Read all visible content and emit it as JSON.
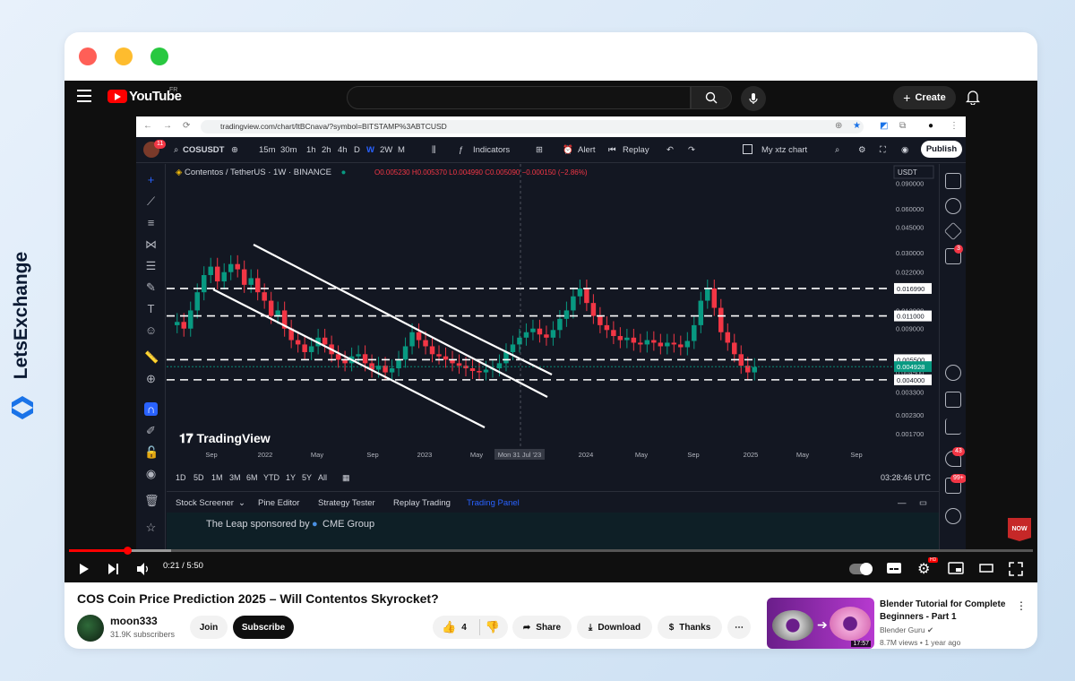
{
  "brand": {
    "name": "LetsExchange"
  },
  "window": {
    "dots": [
      "#ff5f57",
      "#febc2e",
      "#28c840"
    ]
  },
  "youtube": {
    "logo_text": "YouTube",
    "country": "FR",
    "create_label": "Create"
  },
  "browser": {
    "url": "tradingview.com/chart/ltBCnava/?symbol=BITSTAMP%3ABTCUSD"
  },
  "tradingview": {
    "avatar_badge": "11",
    "symbol": "COSUSDT",
    "intervals": [
      "15m",
      "30m",
      "1h",
      "2h",
      "4h",
      "D",
      "W",
      "2W",
      "M"
    ],
    "active_interval": "W",
    "indicators_label": "Indicators",
    "alert_label": "Alert",
    "replay_label": "Replay",
    "layout_name": "My xtz chart",
    "publish_label": "Publish",
    "symbol_line": "Contentos / TetherUS · 1W · BINANCE",
    "ohlc": "O0.005230 H0.005370 L0.004990 C0.005090 −0.000150 (−2.86%)",
    "currency": "USDT",
    "watermark": "TradingView",
    "ranges": [
      "1D",
      "5D",
      "1M",
      "3M",
      "6M",
      "YTD",
      "1Y",
      "5Y",
      "All"
    ],
    "clock": "03:28:46 UTC",
    "panel_tabs": [
      "Stock Screener",
      "Pine Editor",
      "Strategy Tester",
      "Replay Trading",
      "Trading Panel"
    ],
    "active_panel_tab": "Trading Panel",
    "panel_text": "The Leap sponsored by",
    "panel_brand": "CME Group",
    "right_badges": {
      "alerts": "3",
      "notifications": "43",
      "news": "99+"
    },
    "now_badge": "NOW"
  },
  "chart_data": {
    "type": "candlestick",
    "title": "Contentos / TetherUS · 1W · BINANCE",
    "x_ticks": [
      "Sep",
      "2022",
      "May",
      "Sep",
      "2023",
      "May",
      "Mon 31 Jul '23",
      "2024",
      "May",
      "Sep",
      "2025",
      "May",
      "Sep"
    ],
    "y_scale": "log",
    "y_ticks": [
      "0.090000",
      "0.060000",
      "0.045000",
      "0.030000",
      "0.022000",
      "0.012000",
      "0.009000",
      "0.004500",
      "0.003300",
      "0.002300",
      "0.001700"
    ],
    "horizontal_levels": [
      "0.016990",
      "0.011000",
      "0.005500",
      "0.004000"
    ],
    "last_price": "0.004928",
    "channel": "descending channel (white trendlines) 2022–2023"
  },
  "player": {
    "current_time": "0:21",
    "duration": "5:50",
    "progress_fraction": 0.06
  },
  "video": {
    "title": "COS Coin Price Prediction 2025 – Will Contentos Skyrocket?",
    "channel": "moon333",
    "subscribers": "31.9K subscribers",
    "join_label": "Join",
    "subscribe_label": "Subscribe",
    "likes": "4",
    "share_label": "Share",
    "download_label": "Download",
    "thanks_label": "Thanks"
  },
  "recommended": {
    "title": "Blender Tutorial for Complete Beginners - Part 1",
    "channel": "Blender Guru",
    "meta": "8.7M views • 1 year ago",
    "duration": "17:57"
  }
}
